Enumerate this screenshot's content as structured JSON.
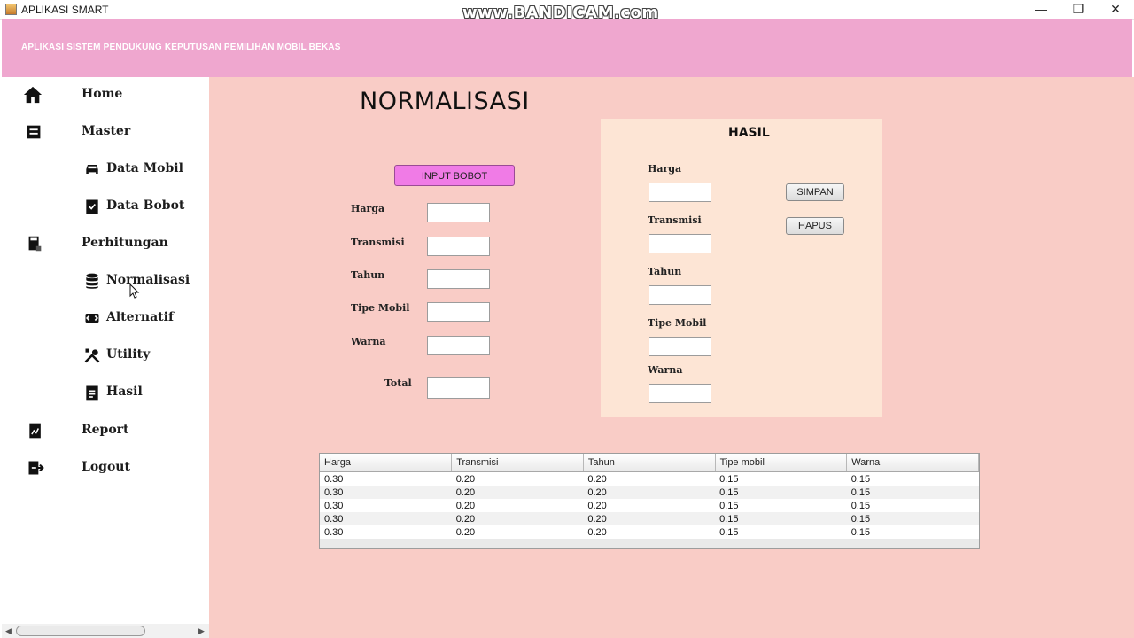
{
  "window": {
    "title": "APLIKASI SMART",
    "watermark": "www.BANDICAM.com",
    "controls": {
      "minimize": "—",
      "maximize": "❐",
      "close": "✕"
    }
  },
  "header": {
    "title": "APLIKASI SISTEM PENDUKUNG KEPUTUSAN PEMILIHAN MOBIL BEKAS"
  },
  "sidebar": {
    "items": [
      {
        "label": "Home",
        "icon": "home-icon"
      },
      {
        "label": "Master",
        "icon": "archive-icon"
      },
      {
        "label": "Data Mobil",
        "icon": "car-icon"
      },
      {
        "label": "Data Bobot",
        "icon": "clipboard-check-icon"
      },
      {
        "label": "Perhitungan",
        "icon": "calculator-icon"
      },
      {
        "label": "Normalisasi",
        "icon": "database-icon"
      },
      {
        "label": "Alternatif",
        "icon": "swap-icon"
      },
      {
        "label": "Utility",
        "icon": "tools-icon"
      },
      {
        "label": "Hasil",
        "icon": "clipboard-list-icon"
      },
      {
        "label": "Report",
        "icon": "chart-file-icon"
      },
      {
        "label": "Logout",
        "icon": "logout-icon"
      }
    ]
  },
  "main": {
    "page_title": "NORMALISASI",
    "input_bobot_button": "INPUT BOBOT",
    "form": {
      "harga_label": "Harga",
      "transmisi_label": "Transmisi",
      "tahun_label": "Tahun",
      "tipe_mobil_label": "Tipe Mobil",
      "warna_label": "Warna",
      "total_label": "Total"
    },
    "hasil": {
      "title": "HASIL",
      "harga_label": "Harga",
      "transmisi_label": "Transmisi",
      "tahun_label": "Tahun",
      "tipe_mobil_label": "Tipe Mobil",
      "warna_label": "Warna",
      "simpan_button": "SIMPAN",
      "hapus_button": "HAPUS"
    },
    "table": {
      "columns": [
        "Harga",
        "Transmisi",
        "Tahun",
        "Tipe mobil",
        "Warna"
      ],
      "rows": [
        [
          "0.30",
          "0.20",
          "0.20",
          "0.15",
          "0.15"
        ],
        [
          "0.30",
          "0.20",
          "0.20",
          "0.15",
          "0.15"
        ],
        [
          "0.30",
          "0.20",
          "0.20",
          "0.15",
          "0.15"
        ],
        [
          "0.30",
          "0.20",
          "0.20",
          "0.15",
          "0.15"
        ],
        [
          "0.30",
          "0.20",
          "0.20",
          "0.15",
          "0.15"
        ]
      ]
    }
  },
  "colors": {
    "header": "#efa7cf",
    "main_background": "#f9ccc6",
    "hasil_panel": "#fde5d5",
    "input_bobot_button": "#f07be6"
  }
}
